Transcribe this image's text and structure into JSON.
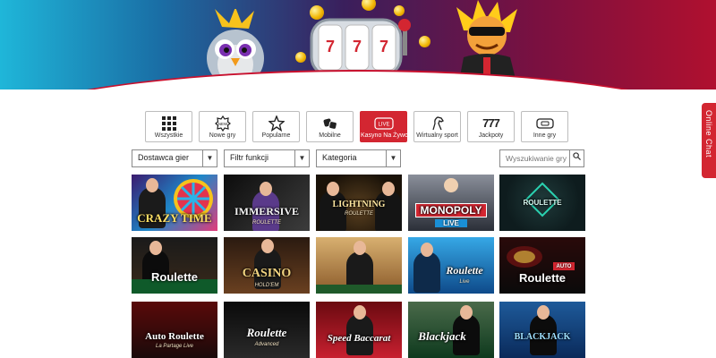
{
  "categories": [
    {
      "label": "Wszystkie",
      "icon": "grid-icon",
      "active": false
    },
    {
      "label": "Nowe gry",
      "icon": "new-badge-icon",
      "active": false
    },
    {
      "label": "Popularne",
      "icon": "star-icon",
      "active": false
    },
    {
      "label": "Mobilne",
      "icon": "chips-icon",
      "active": false
    },
    {
      "label": "Kasyno Na Żywo",
      "icon": "live-icon",
      "active": true
    },
    {
      "label": "Wirtualny sport",
      "icon": "horse-icon",
      "active": false
    },
    {
      "label": "Jackpoty",
      "icon": "777-icon",
      "active": false
    },
    {
      "label": "Inne gry",
      "icon": "ticket-icon",
      "active": false
    }
  ],
  "category_icon_glyphs": [
    "",
    "",
    "",
    "",
    "LIVE",
    "",
    "777",
    ""
  ],
  "filters": {
    "provider": "Dostawca gier",
    "features": "Filtr funkcji",
    "category": "Kategoria"
  },
  "search": {
    "placeholder": "Wyszukiwanie gry"
  },
  "games": [
    {
      "title": "CRAZY TIME",
      "subtitle": ""
    },
    {
      "title": "IMMERSIVE",
      "subtitle": "ROULETTE"
    },
    {
      "title": "LIGHTNING",
      "subtitle": "ROULETTE"
    },
    {
      "title": "MONOPOLY",
      "subtitle": "LIVE"
    },
    {
      "title": "ROULETTE",
      "subtitle": ""
    },
    {
      "title": "Roulette",
      "subtitle": ""
    },
    {
      "title": "CASINO",
      "subtitle": "HOLD'EM"
    },
    {
      "title": "",
      "subtitle": ""
    },
    {
      "title": "Roulette",
      "subtitle": "Live"
    },
    {
      "title": "Roulette",
      "subtitle": "AUTO"
    },
    {
      "title": "Auto Roulette",
      "subtitle": "La Partage Live"
    },
    {
      "title": "Roulette",
      "subtitle": "Advanced"
    },
    {
      "title": "Speed Baccarat",
      "subtitle": ""
    },
    {
      "title": "Blackjack",
      "subtitle": ""
    },
    {
      "title": "BLACKJACK",
      "subtitle": ""
    }
  ],
  "chat": {
    "label": "Online Chat"
  },
  "colors": {
    "accent": "#d32631",
    "border": "#bdbdbd"
  }
}
